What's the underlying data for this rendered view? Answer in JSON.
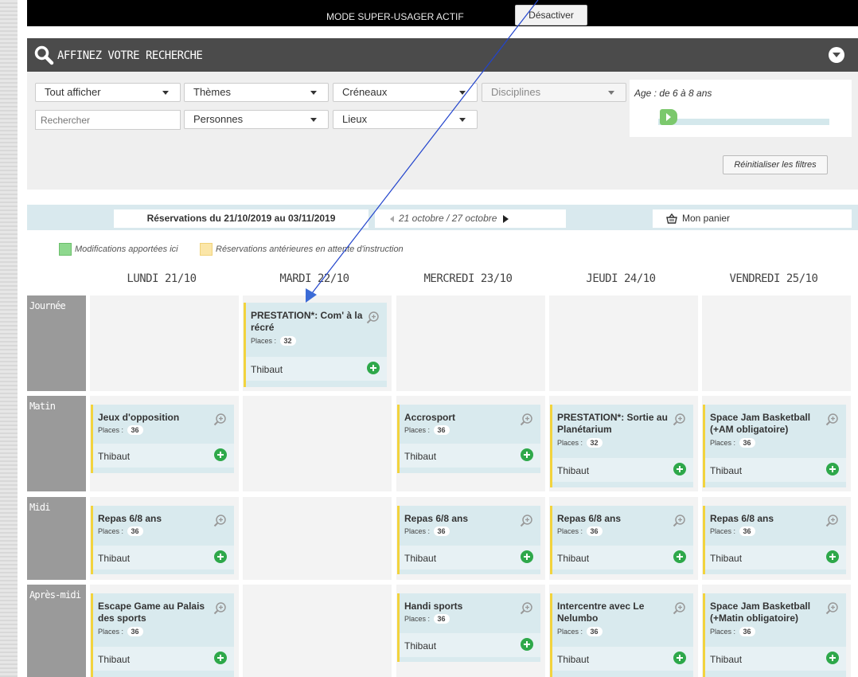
{
  "topbar": {
    "mode_text": "MODE SUPER-USAGER ACTIF",
    "deactivate_label": "Désactiver"
  },
  "search": {
    "title": "AFFINEZ VOTRE RECHERCHE",
    "filters": {
      "show_all": "Tout afficher",
      "themes": "Thèmes",
      "slots": "Créneaux",
      "disciplines": "Disciplines",
      "persons": "Personnes",
      "places": "Lieux"
    },
    "search_placeholder": "Rechercher",
    "age_label": "Age : de 6 à 8 ans",
    "reset_label": "Réinitialiser les filtres"
  },
  "info": {
    "period": "Réservations du 21/10/2019 au 03/11/2019",
    "week": "21 octobre / 27 octobre",
    "cart": "Mon panier"
  },
  "legend": {
    "modified": "Modifications apportées ici",
    "pending": "Réservations antérieures en attente d'instruction",
    "modified_color": "#8ed88e",
    "pending_color": "#fbe6a8"
  },
  "days": [
    "LUNDI 21/10",
    "MARDI 22/10",
    "MERCREDI 23/10",
    "JEUDI 24/10",
    "VENDREDI 25/10"
  ],
  "slots": [
    "Journée",
    "Matin",
    "Midi",
    "Après-midi"
  ],
  "places_label": "Places :",
  "cards": {
    "journee_mardi": {
      "name": "PRESTATION*: Com' à la récré",
      "places": "32",
      "person": "Thibaut"
    },
    "matin_lundi": {
      "name": "Jeux d'opposition",
      "places": "36",
      "person": "Thibaut"
    },
    "matin_mercredi": {
      "name": "Accrosport",
      "places": "36",
      "person": "Thibaut"
    },
    "matin_jeudi": {
      "name": "PRESTATION*: Sortie au Planétarium",
      "places": "32",
      "person": "Thibaut"
    },
    "matin_vendredi": {
      "name": "Space Jam Basketball (+AM obligatoire)",
      "places": "36",
      "person": "Thibaut"
    },
    "midi_lundi": {
      "name": "Repas 6/8 ans",
      "places": "36",
      "person": "Thibaut"
    },
    "midi_mercredi": {
      "name": "Repas 6/8 ans",
      "places": "36",
      "person": "Thibaut"
    },
    "midi_jeudi": {
      "name": "Repas 6/8 ans",
      "places": "36",
      "person": "Thibaut"
    },
    "midi_vendredi": {
      "name": "Repas 6/8 ans",
      "places": "36",
      "person": "Thibaut"
    },
    "am_lundi": {
      "name": "Escape Game au Palais des sports",
      "places": "36",
      "person": "Thibaut"
    },
    "am_mercredi": {
      "name": "Handi sports",
      "places": "36",
      "person": "Thibaut"
    },
    "am_jeudi": {
      "name": "Intercentre avec Le Nelumbo",
      "places": "36",
      "person": "Thibaut"
    },
    "am_vendredi": {
      "name": "Space Jam Basketball (+Matin obligatoire)",
      "places": "36",
      "person": "Thibaut"
    }
  },
  "colors": {
    "card_bg": "#d9eaee",
    "card_border": "#f2d33d",
    "add_green": "#2ea84a",
    "annotation_arrow": "#2244cc"
  }
}
